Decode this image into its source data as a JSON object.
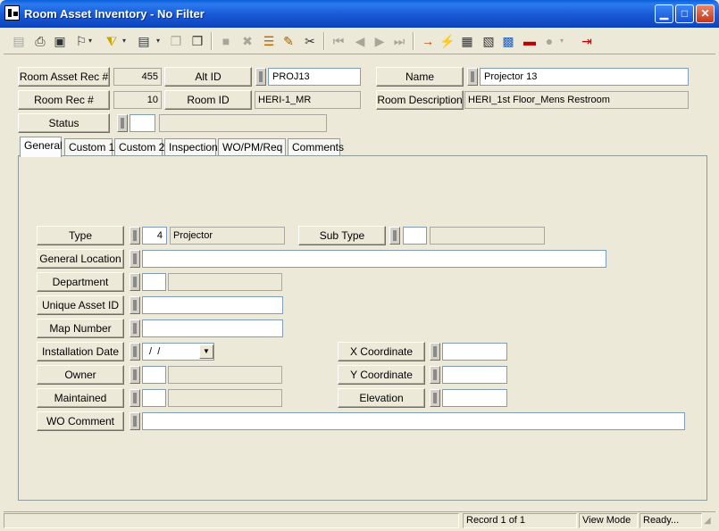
{
  "window": {
    "title": "Room Asset Inventory - No Filter"
  },
  "header": {
    "room_asset_rec_label": "Room Asset Rec #",
    "room_asset_rec_value": "455",
    "alt_id_label": "Alt ID",
    "alt_id_value": "PROJ13",
    "name_label": "Name",
    "name_value": "Projector 13",
    "room_rec_label": "Room Rec #",
    "room_rec_value": "10",
    "room_id_label": "Room ID",
    "room_id_value": "HERI-1_MR",
    "room_description_label": "Room Description",
    "room_description_value": "HERI_1st Floor_Mens Restroom",
    "status_label": "Status",
    "status_code": "",
    "status_description": ""
  },
  "tabs": [
    {
      "label": "General",
      "active": true
    },
    {
      "label": "Custom 1"
    },
    {
      "label": "Custom 2"
    },
    {
      "label": "Inspection"
    },
    {
      "label": "WO/PM/Req"
    },
    {
      "label": "Comments"
    }
  ],
  "general": {
    "type_label": "Type",
    "type_code": "4",
    "type_description": "Projector",
    "sub_type_label": "Sub Type",
    "sub_type_code": "",
    "sub_type_description": "",
    "general_location_label": "General Location",
    "general_location_value": "",
    "department_label": "Department",
    "department_code": "",
    "department_description": "",
    "unique_asset_id_label": "Unique Asset ID",
    "unique_asset_id_value": "",
    "map_number_label": "Map Number",
    "map_number_value": "",
    "installation_date_label": "Installation Date",
    "installation_date_value": " /  /",
    "x_coordinate_label": "X Coordinate",
    "x_coordinate_value": "",
    "owner_label": "Owner",
    "owner_code": "",
    "owner_description": "",
    "y_coordinate_label": "Y Coordinate",
    "y_coordinate_value": "",
    "maintained_label": "Maintained",
    "maintained_code": "",
    "maintained_description": "",
    "elevation_label": "Elevation",
    "elevation_value": "",
    "wo_comment_label": "WO Comment",
    "wo_comment_value": ""
  },
  "status_bar": {
    "record": "Record 1 of 1",
    "mode": "View Mode",
    "state": "Ready..."
  },
  "toolbar_icons": [
    "new-icon",
    "print-icon",
    "preview-icon",
    "binoculars-icon",
    "filter-icon",
    "report-icon",
    "copy-icon",
    "paste-icon",
    "delete-icon",
    "cancel-icon",
    "stack-icon",
    "edit-icon",
    "cut-icon",
    "first-record-icon",
    "prev-record-icon",
    "next-record-icon",
    "last-record-icon",
    "goto-icon",
    "lightning-icon",
    "hierarchy-icon",
    "tree-icon",
    "map-icon",
    "fire-truck-icon",
    "globe-icon",
    "exit-icon"
  ]
}
